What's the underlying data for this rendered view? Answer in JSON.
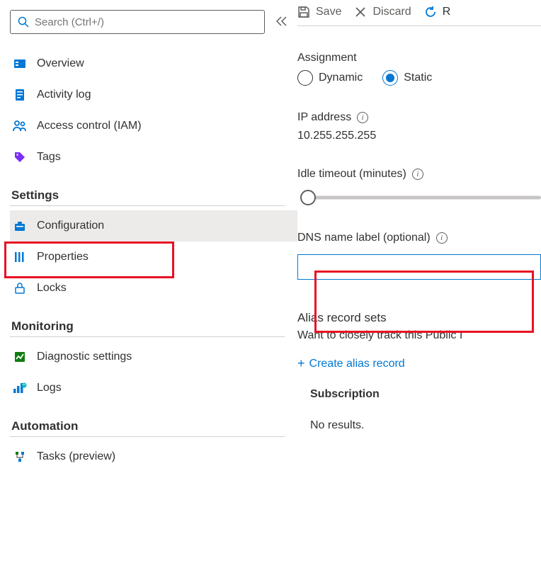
{
  "search": {
    "placeholder": "Search (Ctrl+/)"
  },
  "nav": {
    "general": [
      {
        "label": "Overview",
        "icon": "overview"
      },
      {
        "label": "Activity log",
        "icon": "log"
      },
      {
        "label": "Access control (IAM)",
        "icon": "iam"
      },
      {
        "label": "Tags",
        "icon": "tag"
      }
    ],
    "sections": [
      {
        "header": "Settings",
        "items": [
          {
            "label": "Configuration",
            "icon": "config",
            "selected": true
          },
          {
            "label": "Properties",
            "icon": "props"
          },
          {
            "label": "Locks",
            "icon": "lock"
          }
        ]
      },
      {
        "header": "Monitoring",
        "items": [
          {
            "label": "Diagnostic settings",
            "icon": "diag"
          },
          {
            "label": "Logs",
            "icon": "logs"
          }
        ]
      },
      {
        "header": "Automation",
        "items": [
          {
            "label": "Tasks (preview)",
            "icon": "tasks"
          }
        ]
      }
    ]
  },
  "toolbar": {
    "save": "Save",
    "discard": "Discard",
    "refresh": "R"
  },
  "main": {
    "assignment": {
      "label": "Assignment",
      "options": [
        "Dynamic",
        "Static"
      ],
      "selected": "Static"
    },
    "ip": {
      "label": "IP address",
      "value": "10.255.255.255"
    },
    "idle": {
      "label": "Idle timeout (minutes)"
    },
    "dns": {
      "label": "DNS name label (optional)",
      "value": ""
    },
    "alias": {
      "header": "Alias record sets",
      "desc": "Want to closely track this Public I",
      "create": "Create alias record"
    },
    "subscription": {
      "title": "Subscription",
      "none": "No results."
    }
  }
}
